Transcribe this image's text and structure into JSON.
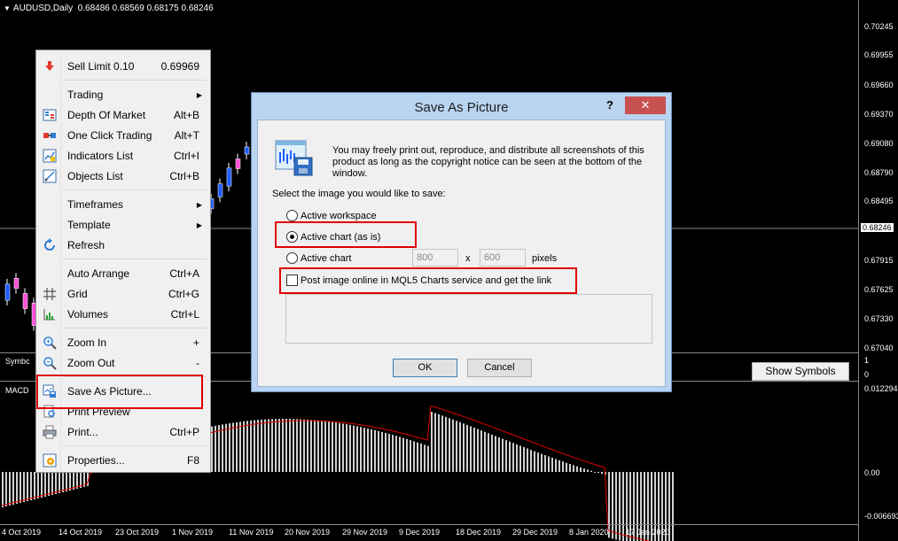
{
  "chart": {
    "title": "AUDUSD,Daily",
    "ohlc": "0.68486 0.68569 0.68175 0.68246",
    "price_levels": [
      "0.70245",
      "0.69955",
      "0.69660",
      "0.69370",
      "0.69080",
      "0.68790",
      "0.68495",
      "0.68246",
      "0.67915",
      "0.67625",
      "0.67330",
      "0.67040"
    ],
    "current_price": "0.68246",
    "dates": [
      "4 Oct 2019",
      "14 Oct 2019",
      "23 Oct 2019",
      "1 Nov 2019",
      "11 Nov 2019",
      "20 Nov 2019",
      "29 Nov 2019",
      "9 Dec 2019",
      "18 Dec 2019",
      "29 Dec 2019",
      "8 Jan 2020",
      "17 Jan 2020"
    ],
    "symbol_label": "Symbc",
    "symbol_axis": [
      "1",
      "0"
    ],
    "macd_label": "MACD",
    "macd_levels": [
      "0.012294",
      "0.00",
      "-0.006693"
    ],
    "show_symbols_label": "Show Symbols",
    "colors": {
      "bull": "#1e5eff",
      "bear": "#ff4fd8",
      "signal": "#e00000",
      "hist": "#d0d0d0"
    }
  },
  "context_menu": {
    "items": [
      {
        "label": "Sell Limit 0.10",
        "shortcut": "0.69969",
        "icon": "sell-limit-icon"
      },
      {
        "label": "Trading",
        "submenu": true
      },
      {
        "label": "Depth Of Market",
        "shortcut": "Alt+B",
        "icon": "depth-of-market-icon"
      },
      {
        "label": "One Click Trading",
        "shortcut": "Alt+T",
        "icon": "one-click-trading-icon"
      },
      {
        "label": "Indicators List",
        "shortcut": "Ctrl+I",
        "icon": "indicators-list-icon"
      },
      {
        "label": "Objects List",
        "shortcut": "Ctrl+B",
        "icon": "objects-list-icon"
      },
      {
        "label": "Timeframes",
        "submenu": true
      },
      {
        "label": "Template",
        "submenu": true
      },
      {
        "label": "Refresh",
        "icon": "refresh-icon"
      },
      {
        "label": "Auto Arrange",
        "shortcut": "Ctrl+A"
      },
      {
        "label": "Grid",
        "shortcut": "Ctrl+G",
        "icon": "grid-icon"
      },
      {
        "label": "Volumes",
        "shortcut": "Ctrl+L",
        "icon": "volumes-icon"
      },
      {
        "label": "Zoom In",
        "shortcut": "+",
        "icon": "zoom-in-icon"
      },
      {
        "label": "Zoom Out",
        "shortcut": "-",
        "icon": "zoom-out-icon"
      },
      {
        "label": "Save As Picture...",
        "icon": "save-as-picture-icon"
      },
      {
        "label": "Print Preview",
        "icon": "print-preview-icon"
      },
      {
        "label": "Print...",
        "shortcut": "Ctrl+P",
        "icon": "print-icon"
      },
      {
        "label": "Properties...",
        "shortcut": "F8",
        "icon": "properties-icon"
      }
    ]
  },
  "dialog": {
    "title": "Save As Picture",
    "help": "?",
    "close": "✕",
    "info_text": "You may freely print out, reproduce, and distribute all screenshots of this product as long as the copyright notice can be seen at the bottom of the window.",
    "prompt": "Select the image you would like to save:",
    "options": {
      "active_workspace": "Active workspace",
      "active_chart_as_is": "Active chart (as is)",
      "active_chart": "Active chart"
    },
    "selected_option": "active_chart_as_is",
    "width_value": "800",
    "x_label": "x",
    "height_value": "600",
    "pixels_label": "pixels",
    "publish_label": "Post image online in MQL5 Charts service and get the link",
    "ok_label": "OK",
    "cancel_label": "Cancel"
  }
}
